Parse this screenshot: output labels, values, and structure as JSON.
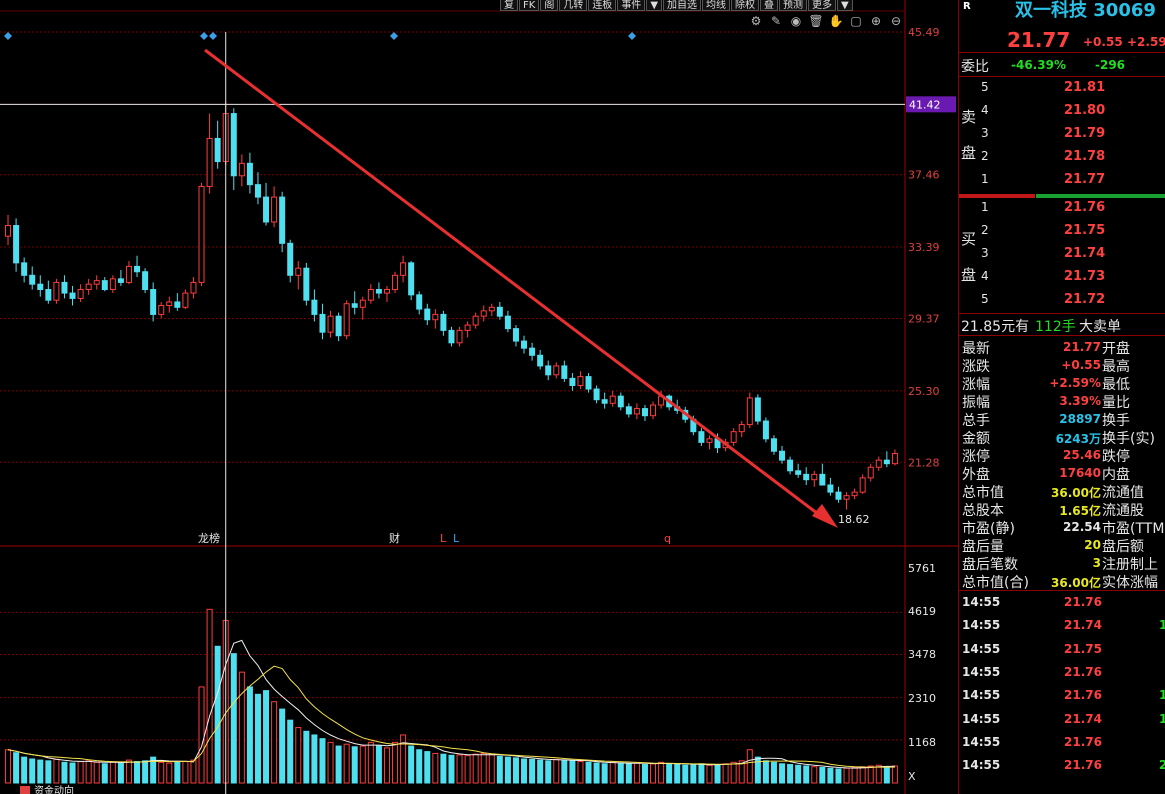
{
  "toolbar": {
    "buttons": [
      "复",
      "FK",
      "阁",
      "几转",
      "连板",
      "事件",
      "▼",
      "加自选",
      "均线",
      "除权",
      "叠",
      "预测",
      "更多",
      "▼"
    ]
  },
  "chart_icons": [
    "gear-icon",
    "pencil-icon",
    "eye-icon",
    "trash-icon",
    "hand-icon",
    "square-icon",
    "zoom-in-icon",
    "zoom-out-icon"
  ],
  "chart_data": {
    "type": "candlestick",
    "price_axis": {
      "labels": [
        "45.49",
        "41.42",
        "37.46",
        "33.39",
        "29.37",
        "25.30",
        "21.28"
      ],
      "values": [
        45.49,
        41.42,
        37.46,
        33.39,
        29.37,
        25.3,
        21.28
      ]
    },
    "crosshair_price": "41.42",
    "low_annotation": "18.62",
    "volume_axis": {
      "labels": [
        "5761",
        "4619",
        "3478",
        "2310",
        "1168",
        "X"
      ],
      "values": [
        5761,
        4619,
        3478,
        2310,
        1168
      ]
    },
    "event_markers": [
      "龙榜",
      "财",
      "L",
      "L",
      "q"
    ],
    "bottom_labels": [
      "资金动向"
    ],
    "candles": [
      [
        34.0,
        35.2,
        33.5,
        34.6
      ],
      [
        34.6,
        35.0,
        32.0,
        32.5
      ],
      [
        32.5,
        32.8,
        31.4,
        31.8
      ],
      [
        31.8,
        32.3,
        31.0,
        31.3
      ],
      [
        31.3,
        31.8,
        30.6,
        31.0
      ],
      [
        31.0,
        31.5,
        30.2,
        30.4
      ],
      [
        30.4,
        31.6,
        30.2,
        31.4
      ],
      [
        31.4,
        31.8,
        30.5,
        30.8
      ],
      [
        30.8,
        31.2,
        30.1,
        30.5
      ],
      [
        30.5,
        31.3,
        30.3,
        31.0
      ],
      [
        31.0,
        31.6,
        30.7,
        31.3
      ],
      [
        31.3,
        31.8,
        31.0,
        31.5
      ],
      [
        31.5,
        31.7,
        30.9,
        31.0
      ],
      [
        31.0,
        31.8,
        30.8,
        31.6
      ],
      [
        31.6,
        32.1,
        31.2,
        31.4
      ],
      [
        31.4,
        32.6,
        31.3,
        32.3
      ],
      [
        32.3,
        32.9,
        31.7,
        32.0
      ],
      [
        32.0,
        32.2,
        30.8,
        31.0
      ],
      [
        31.0,
        31.4,
        29.2,
        29.6
      ],
      [
        29.6,
        30.3,
        29.4,
        30.1
      ],
      [
        30.1,
        30.6,
        29.7,
        30.3
      ],
      [
        30.3,
        30.8,
        29.8,
        30.0
      ],
      [
        30.0,
        31.0,
        29.9,
        30.8
      ],
      [
        30.8,
        31.7,
        30.5,
        31.4
      ],
      [
        31.4,
        37.0,
        31.2,
        36.8
      ],
      [
        36.8,
        40.9,
        36.4,
        39.5
      ],
      [
        39.5,
        40.5,
        37.8,
        38.2
      ],
      [
        38.2,
        41.6,
        38.0,
        40.9
      ],
      [
        40.9,
        41.2,
        36.6,
        37.4
      ],
      [
        37.4,
        38.6,
        36.8,
        38.1
      ],
      [
        38.1,
        38.7,
        36.4,
        36.9
      ],
      [
        36.9,
        37.6,
        35.8,
        36.2
      ],
      [
        36.2,
        37.0,
        34.6,
        34.8
      ],
      [
        34.8,
        36.8,
        34.5,
        36.2
      ],
      [
        36.2,
        36.5,
        33.1,
        33.6
      ],
      [
        33.6,
        33.8,
        31.4,
        31.8
      ],
      [
        31.8,
        32.6,
        31.0,
        32.2
      ],
      [
        32.2,
        32.5,
        30.1,
        30.4
      ],
      [
        30.4,
        31.0,
        29.2,
        29.6
      ],
      [
        29.6,
        30.2,
        28.2,
        28.6
      ],
      [
        28.6,
        29.8,
        28.3,
        29.5
      ],
      [
        29.5,
        29.7,
        28.1,
        28.4
      ],
      [
        28.4,
        30.4,
        28.2,
        30.2
      ],
      [
        30.2,
        30.9,
        29.6,
        30.0
      ],
      [
        30.0,
        30.6,
        29.3,
        30.4
      ],
      [
        30.4,
        31.3,
        30.2,
        31.0
      ],
      [
        31.0,
        31.4,
        30.5,
        30.8
      ],
      [
        30.8,
        31.2,
        30.3,
        31.0
      ],
      [
        31.0,
        32.0,
        30.8,
        31.8
      ],
      [
        31.8,
        32.9,
        31.4,
        32.5
      ],
      [
        32.5,
        32.6,
        30.4,
        30.7
      ],
      [
        30.7,
        30.9,
        29.6,
        29.9
      ],
      [
        29.9,
        30.2,
        29.0,
        29.3
      ],
      [
        29.3,
        29.9,
        28.8,
        29.6
      ],
      [
        29.6,
        29.8,
        28.4,
        28.7
      ],
      [
        28.7,
        28.9,
        27.8,
        28.0
      ],
      [
        28.0,
        28.9,
        27.8,
        28.7
      ],
      [
        28.7,
        29.2,
        28.3,
        29.0
      ],
      [
        29.0,
        29.7,
        28.8,
        29.5
      ],
      [
        29.5,
        30.1,
        29.2,
        29.8
      ],
      [
        29.8,
        30.2,
        29.5,
        30.0
      ],
      [
        30.0,
        30.3,
        29.3,
        29.5
      ],
      [
        29.5,
        29.8,
        28.6,
        28.8
      ],
      [
        28.8,
        29.0,
        27.8,
        28.1
      ],
      [
        28.1,
        28.4,
        27.4,
        27.7
      ],
      [
        27.7,
        28.0,
        27.0,
        27.3
      ],
      [
        27.3,
        27.6,
        26.5,
        26.7
      ],
      [
        26.7,
        27.0,
        25.9,
        26.2
      ],
      [
        26.2,
        26.9,
        26.0,
        26.7
      ],
      [
        26.7,
        27.0,
        25.8,
        26.0
      ],
      [
        26.0,
        26.3,
        25.3,
        25.6
      ],
      [
        25.6,
        26.4,
        25.4,
        26.1
      ],
      [
        26.1,
        26.3,
        25.2,
        25.4
      ],
      [
        25.4,
        25.6,
        24.6,
        24.8
      ],
      [
        24.8,
        25.2,
        24.3,
        24.6
      ],
      [
        24.6,
        25.3,
        24.4,
        25.0
      ],
      [
        25.0,
        25.2,
        24.2,
        24.4
      ],
      [
        24.4,
        24.6,
        23.8,
        24.0
      ],
      [
        24.0,
        24.6,
        23.7,
        24.3
      ],
      [
        24.3,
        24.5,
        23.6,
        23.9
      ],
      [
        23.9,
        24.7,
        23.7,
        24.5
      ],
      [
        24.5,
        25.3,
        24.3,
        25.0
      ],
      [
        25.0,
        25.1,
        24.2,
        24.4
      ],
      [
        24.4,
        24.8,
        24.0,
        24.2
      ],
      [
        24.2,
        24.4,
        23.5,
        23.7
      ],
      [
        23.7,
        23.9,
        22.8,
        23.0
      ],
      [
        23.0,
        23.2,
        22.2,
        22.4
      ],
      [
        22.4,
        22.8,
        22.0,
        22.6
      ],
      [
        22.6,
        22.9,
        21.8,
        22.1
      ],
      [
        22.1,
        22.6,
        21.9,
        22.4
      ],
      [
        22.4,
        23.2,
        22.2,
        23.0
      ],
      [
        23.0,
        23.6,
        22.7,
        23.4
      ],
      [
        23.4,
        25.2,
        23.2,
        24.9
      ],
      [
        24.9,
        25.1,
        23.4,
        23.6
      ],
      [
        23.6,
        23.8,
        22.4,
        22.6
      ],
      [
        22.6,
        22.8,
        21.7,
        21.9
      ],
      [
        21.9,
        22.2,
        21.2,
        21.4
      ],
      [
        21.4,
        21.6,
        20.6,
        20.8
      ],
      [
        20.8,
        21.2,
        20.4,
        20.6
      ],
      [
        20.6,
        21.0,
        20.0,
        20.3
      ],
      [
        20.3,
        20.8,
        19.9,
        20.6
      ],
      [
        20.6,
        21.2,
        20.2,
        20.0
      ],
      [
        20.0,
        20.4,
        19.4,
        19.6
      ],
      [
        19.6,
        19.9,
        19.0,
        19.2
      ],
      [
        19.2,
        19.6,
        18.62,
        19.4
      ],
      [
        19.4,
        19.8,
        19.2,
        19.6
      ],
      [
        19.6,
        20.6,
        19.5,
        20.4
      ],
      [
        20.4,
        21.2,
        20.2,
        21.0
      ],
      [
        21.0,
        21.6,
        20.8,
        21.4
      ],
      [
        21.4,
        21.9,
        21.0,
        21.2
      ],
      [
        21.2,
        22.0,
        21.1,
        21.77
      ]
    ],
    "volumes": [
      900,
      820,
      700,
      650,
      620,
      600,
      640,
      560,
      540,
      580,
      600,
      560,
      520,
      560,
      540,
      620,
      580,
      600,
      700,
      560,
      540,
      560,
      580,
      620,
      2600,
      4700,
      3700,
      4400,
      3500,
      3000,
      2600,
      2400,
      2500,
      2200,
      2000,
      1700,
      1500,
      1400,
      1300,
      1200,
      1100,
      1000,
      1050,
      980,
      1000,
      1100,
      1000,
      950,
      1100,
      1300,
      1000,
      900,
      850,
      800,
      780,
      750,
      760,
      740,
      780,
      800,
      760,
      720,
      700,
      680,
      650,
      640,
      620,
      600,
      640,
      620,
      600,
      580,
      560,
      540,
      520,
      560,
      540,
      520,
      540,
      500,
      520,
      560,
      520,
      500,
      480,
      500,
      520,
      480,
      500,
      520,
      560,
      600,
      900,
      700,
      600,
      560,
      520,
      500,
      480,
      460,
      440,
      420,
      400,
      380,
      400,
      420,
      440,
      460,
      480,
      440,
      460
    ],
    "crosshair_index": 27
  },
  "panel": {
    "r_mark": "R",
    "stock_name": "双一科技 30069",
    "last_price": "21.77",
    "change": "+0.55",
    "change_pct": "+2.59",
    "weibi_label": "委比",
    "weibi_pct": "-46.39%",
    "weicha": "-296",
    "sell_label": [
      "卖",
      "盘"
    ],
    "buy_label": [
      "买",
      "盘"
    ],
    "sell": [
      {
        "lvl": "5",
        "price": "21.81"
      },
      {
        "lvl": "4",
        "price": "21.80"
      },
      {
        "lvl": "3",
        "price": "21.79"
      },
      {
        "lvl": "2",
        "price": "21.78"
      },
      {
        "lvl": "1",
        "price": "21.77"
      }
    ],
    "buy": [
      {
        "lvl": "1",
        "price": "21.76"
      },
      {
        "lvl": "2",
        "price": "21.75"
      },
      {
        "lvl": "3",
        "price": "21.74"
      },
      {
        "lvl": "4",
        "price": "21.73"
      },
      {
        "lvl": "5",
        "price": "21.72"
      }
    ],
    "big_order": {
      "price": "21.85元有",
      "qty": "112手",
      "text": "大卖单"
    },
    "info": [
      {
        "label": "最新",
        "value": "21.77",
        "vclass": "red",
        "label2": "开盘"
      },
      {
        "label": "涨跌",
        "value": "+0.55",
        "vclass": "red",
        "label2": "最高"
      },
      {
        "label": "涨幅",
        "value": "+2.59%",
        "vclass": "red",
        "label2": "最低"
      },
      {
        "label": "振幅",
        "value": "3.39%",
        "vclass": "red",
        "label2": "量比"
      },
      {
        "label": "总手",
        "value": "28897",
        "vclass": "cyan",
        "label2": "换手"
      },
      {
        "label": "金额",
        "value": "6243万",
        "vclass": "cyan",
        "label2": "换手(实)"
      },
      {
        "label": "涨停",
        "value": "25.46",
        "vclass": "red",
        "label2": "跌停"
      },
      {
        "label": "外盘",
        "value": "17640",
        "vclass": "red",
        "label2": "内盘"
      },
      {
        "label": "总市值",
        "value": "36.00亿",
        "vclass": "yel",
        "label2": "流通值"
      },
      {
        "label": "总股本",
        "value": "1.65亿",
        "vclass": "yel",
        "label2": "流通股"
      },
      {
        "label": "市盈(静)",
        "value": "22.54",
        "vclass": "wht",
        "label2": "市盈(TTM"
      },
      {
        "label": "盘后量",
        "value": "20",
        "vclass": "yel",
        "label2": "盘后额"
      },
      {
        "label": "盘后笔数",
        "value": "3",
        "vclass": "yel",
        "label2": "注册制上"
      },
      {
        "label": "总市值(合)",
        "value": "36.00亿",
        "vclass": "yel",
        "label2": "实体涨幅"
      }
    ],
    "trades": [
      {
        "time": "14:55",
        "price": "21.76",
        "pclass": "red",
        "vol": ""
      },
      {
        "time": "14:55",
        "price": "21.74",
        "pclass": "red",
        "vol": "1"
      },
      {
        "time": "14:55",
        "price": "21.75",
        "pclass": "red",
        "vol": ""
      },
      {
        "time": "14:55",
        "price": "21.76",
        "pclass": "red",
        "vol": ""
      },
      {
        "time": "14:55",
        "price": "21.76",
        "pclass": "red",
        "vol": "1"
      },
      {
        "time": "14:55",
        "price": "21.74",
        "pclass": "red",
        "vol": "1"
      },
      {
        "time": "14:55",
        "price": "21.76",
        "pclass": "red",
        "vol": ""
      },
      {
        "time": "14:55",
        "price": "21.76",
        "pclass": "red",
        "vol": "2"
      }
    ]
  },
  "colors": {
    "up": "#ff3c3c",
    "down": "#4fe0f0",
    "grid": "#7a0000",
    "ma1": "#f0f0f0",
    "ma2": "#f5e14a"
  }
}
